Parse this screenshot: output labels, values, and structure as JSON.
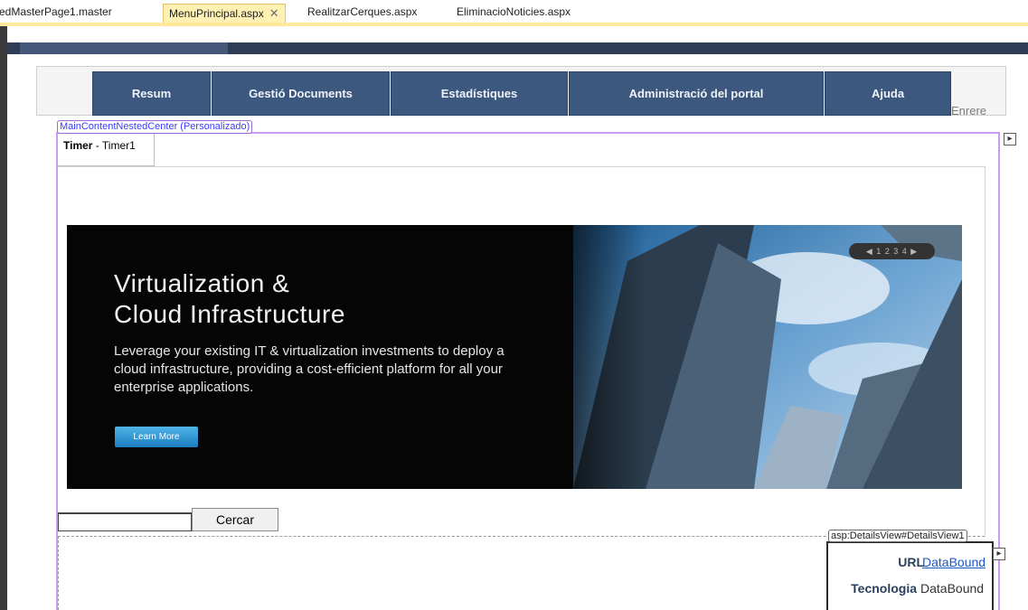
{
  "tabs": [
    {
      "label": "edMasterPage1.master",
      "active": false
    },
    {
      "label": "MenuPrincipal.aspx",
      "active": true
    },
    {
      "label": "RealitzarCerques.aspx",
      "active": false
    },
    {
      "label": "EliminacioNoticies.aspx",
      "active": false
    }
  ],
  "menu": {
    "items": [
      "Resum",
      "Gestió Documents",
      "Estadístiques",
      "Administració del portal",
      "Ajuda"
    ],
    "back_label": "Enrere",
    "color": "#3c587e"
  },
  "designer": {
    "content_tag": "MainContentNestedCenter (Personalizado)",
    "timer_tab_bold": "Timer",
    "timer_tab_rest": " - Timer1",
    "smart_tag_icon": "chevron-right-icon"
  },
  "banner": {
    "title_line1": "Virtualization &",
    "title_line2": "Cloud Infrastructure",
    "body": "Leverage your existing IT & virtualization investments to deploy a cloud infrastructure, providing a cost-efficient platform for all your enterprise applications.",
    "button_label": "Learn More",
    "pager": "◀ 1 2 3 4 ▶"
  },
  "search": {
    "value": "",
    "button_label": "Cercar"
  },
  "details_view": {
    "tag": "asp:DetailsView#DetailsView1",
    "rows": [
      {
        "label": "URL",
        "value": "DataBound"
      },
      {
        "label": "Tecnologia",
        "value": "DataBound"
      }
    ]
  }
}
